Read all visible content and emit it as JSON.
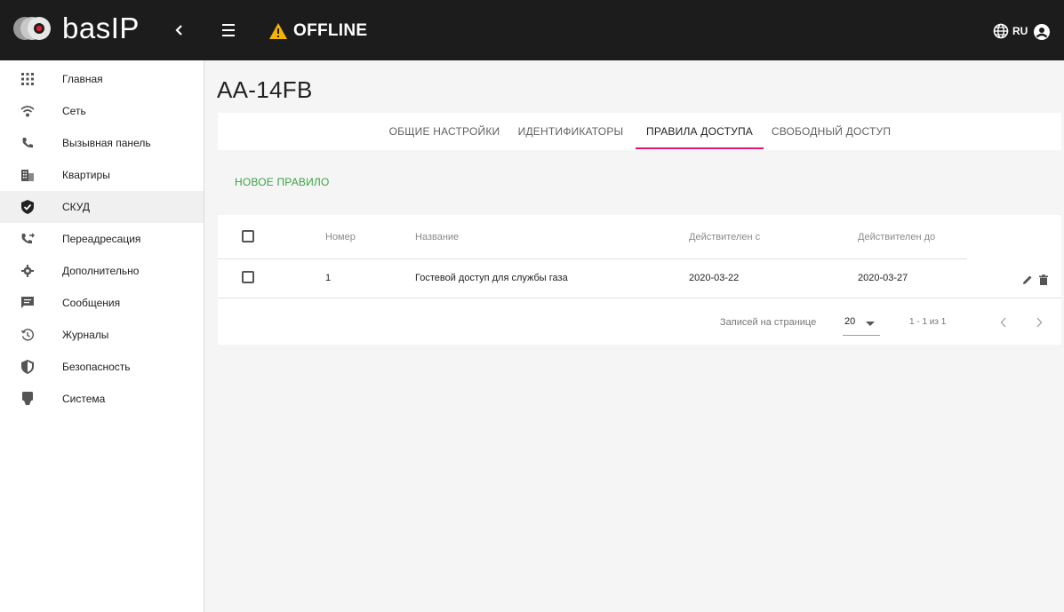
{
  "app": {
    "logo_text": "basIP",
    "status_text": "OFFLINE",
    "language": "RU",
    "colors": {
      "topbar": "#1c1c1c",
      "warning": "#f5b400",
      "accent": "#e0146e",
      "link": "#3aa346"
    }
  },
  "sidebar": {
    "items": [
      {
        "label": "Главная",
        "icon": "apps-grid-icon"
      },
      {
        "label": "Сеть",
        "icon": "wifi-icon"
      },
      {
        "label": "Вызывная панель",
        "icon": "phone-icon"
      },
      {
        "label": "Квартиры",
        "icon": "building-icon"
      },
      {
        "label": "СКУД",
        "icon": "shield-check-icon",
        "active": true
      },
      {
        "label": "Переадресация",
        "icon": "phone-forward-icon"
      },
      {
        "label": "Дополнительно",
        "icon": "gear-icon"
      },
      {
        "label": "Сообщения",
        "icon": "message-icon"
      },
      {
        "label": "Журналы",
        "icon": "history-icon"
      },
      {
        "label": "Безопасность",
        "icon": "security-icon"
      },
      {
        "label": "Система",
        "icon": "device-icon"
      }
    ]
  },
  "page": {
    "title": "AA-14FB"
  },
  "tabs": [
    {
      "label": "ОБЩИЕ НАСТРОЙКИ"
    },
    {
      "label": "ИДЕНТИФИКАТОРЫ"
    },
    {
      "label": "ПРАВИЛА ДОСТУПА",
      "active": true
    },
    {
      "label": "СВОБОДНЫЙ ДОСТУП"
    }
  ],
  "actions": {
    "new_rule": "НОВОЕ ПРАВИЛО"
  },
  "table": {
    "columns": [
      "Номер",
      "Название",
      "Действителен с",
      "Действителен до"
    ],
    "rows": [
      {
        "number": "1",
        "name": "Гостевой доступ для службы газа",
        "valid_from": "2020-03-22",
        "valid_to": "2020-03-27"
      }
    ]
  },
  "pagination": {
    "per_page_label": "Записей на странице",
    "per_page_value": "20",
    "range": "1 - 1 из 1"
  }
}
